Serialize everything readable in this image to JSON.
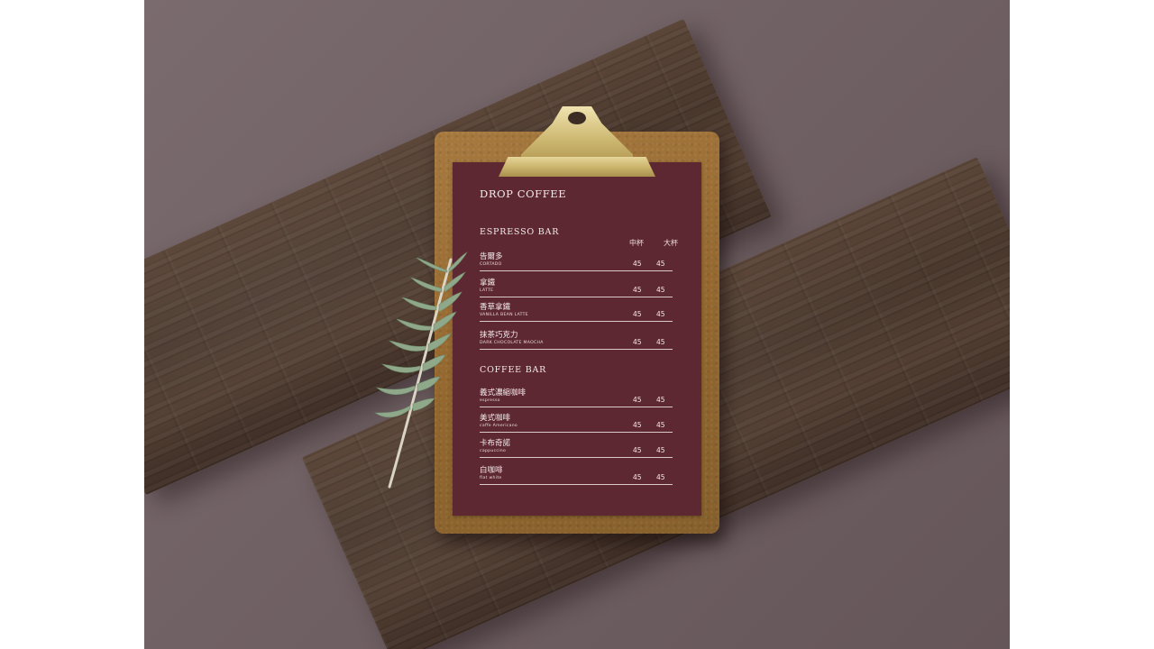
{
  "menu": {
    "title": "DROP COFFEE",
    "size_labels": [
      "中杯",
      "大杯"
    ],
    "sections": [
      {
        "title": "ESPRESSO BAR",
        "items": [
          {
            "zh": "告爾多",
            "en": "CORTADO",
            "price_medium": "45",
            "price_large": "45"
          },
          {
            "zh": "拿鐵",
            "en": "LATTE",
            "price_medium": "45",
            "price_large": "45"
          },
          {
            "zh": "香草拿鐵",
            "en": "VANILLA BEAN LATTE",
            "price_medium": "45",
            "price_large": "45"
          },
          {
            "zh": "抹茶巧克力",
            "en": "DARK CHOCOLATE MAOCHA",
            "price_medium": "45",
            "price_large": "45"
          }
        ]
      },
      {
        "title": "COFFEE  BAR",
        "items": [
          {
            "zh": "義式濃縮咖啡",
            "en": "espresso",
            "price_medium": "45",
            "price_large": "45"
          },
          {
            "zh": "美式咖啡",
            "en": "caffe Americano",
            "price_medium": "45",
            "price_large": "45"
          },
          {
            "zh": "卡布奇諾",
            "en": "cappuccino",
            "price_medium": "45",
            "price_large": "45"
          },
          {
            "zh": "白咖啡",
            "en": "flat white",
            "price_medium": "45",
            "price_large": "45"
          }
        ]
      }
    ]
  },
  "colors": {
    "background": "#6e5f62",
    "wood": "#4a382d",
    "clipboard": "#94682f",
    "menu_paper": "#5e2832",
    "clip_metal": "#cdb871",
    "rosemary": "#8fa88a"
  },
  "icons": {
    "clip": "binder-clip-icon",
    "herb": "rosemary-sprig-icon"
  }
}
